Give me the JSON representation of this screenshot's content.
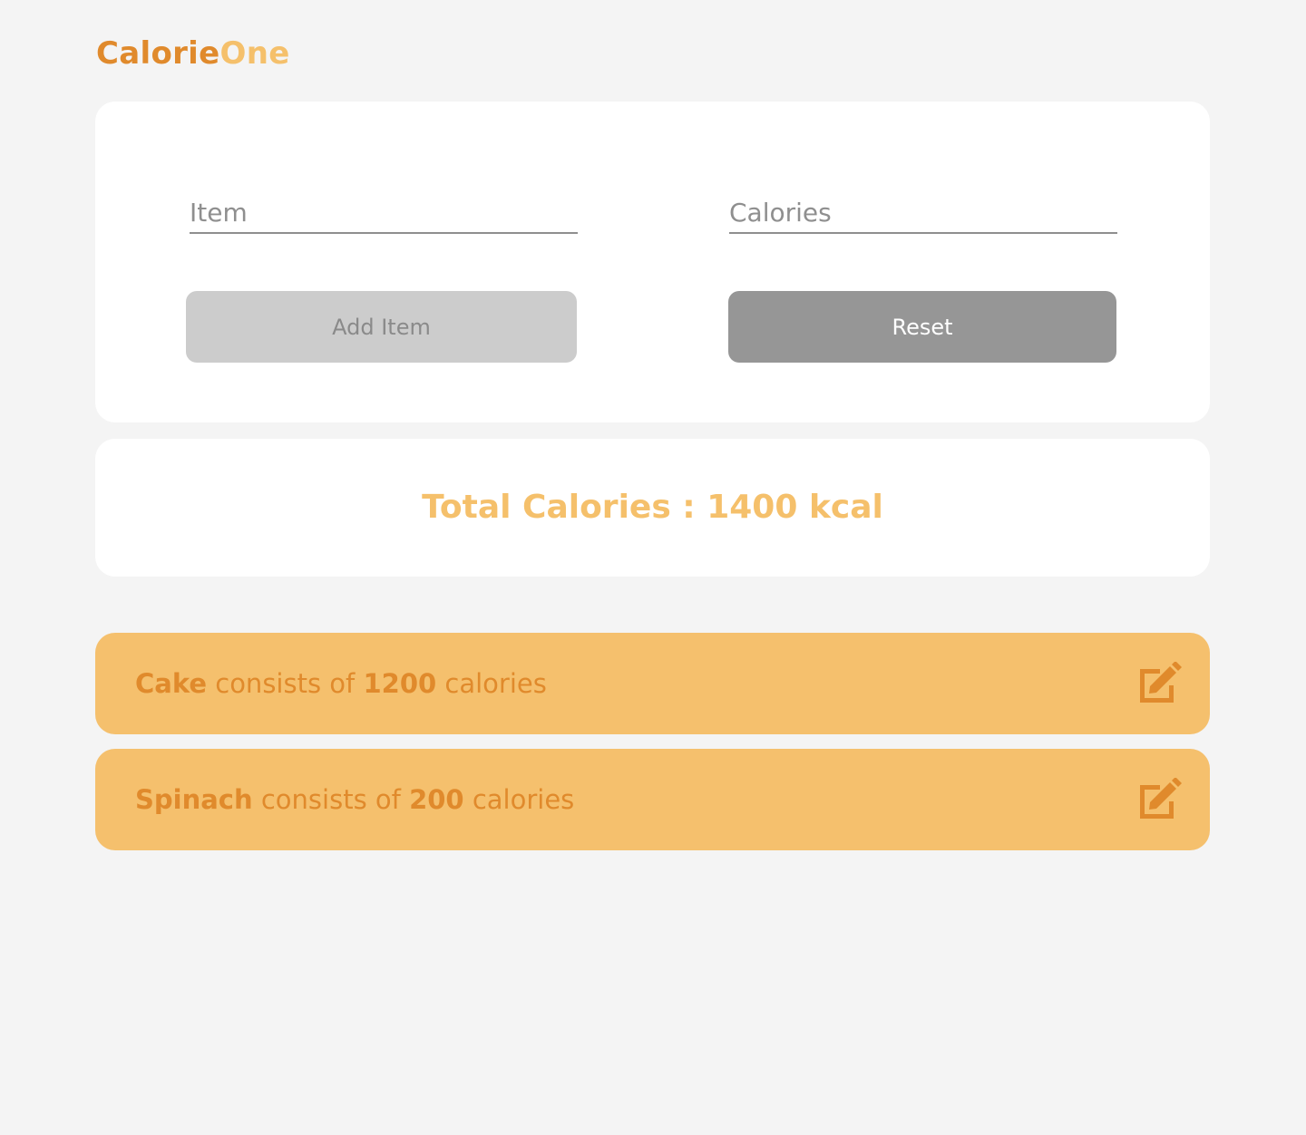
{
  "app": {
    "logo_part1": "Calorie",
    "logo_part2": "One"
  },
  "form": {
    "item_placeholder": "Item",
    "item_value": "",
    "calories_placeholder": "Calories",
    "calories_value": "",
    "add_button_label": "Add Item",
    "reset_button_label": "Reset"
  },
  "summary": {
    "total_text": "Total Calories : 1400 kcal"
  },
  "items": [
    {
      "name": "Cake",
      "middle_text": " consists of ",
      "calories": "1200",
      "suffix_text": " calories",
      "icon": "edit-icon"
    },
    {
      "name": "Spinach",
      "middle_text": " consists of ",
      "calories": "200",
      "suffix_text": " calories",
      "icon": "edit-icon"
    }
  ],
  "colors": {
    "brand_dark": "#e08a2c",
    "brand_light": "#f5c06b",
    "item_bg": "#f5c06d",
    "page_bg": "#f4f4f4",
    "disabled_button": "#cccccc",
    "reset_button": "#969696"
  }
}
